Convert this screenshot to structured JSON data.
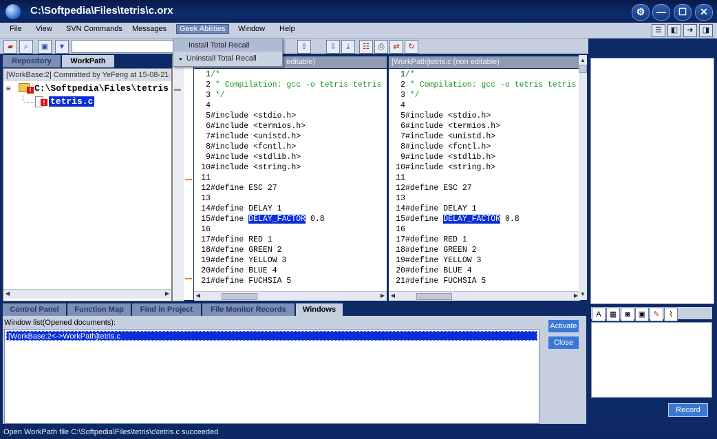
{
  "window": {
    "title": "C:\\Softpedia\\Files\\tetris\\c.orx",
    "controls": [
      "⚙",
      "—",
      "☐",
      "✕"
    ]
  },
  "menubar": {
    "items": [
      "File",
      "View",
      "SVN Commands",
      "Messages",
      "Geek Abilities",
      "Window",
      "Help"
    ],
    "active": "Geek Abilities"
  },
  "dropdown": {
    "items": [
      "Install Total Recall",
      "Uninstall Total Recall"
    ],
    "selected_bullet": "●"
  },
  "left": {
    "tabs": [
      "Repository",
      "WorkPath"
    ],
    "active_tab": "WorkPath",
    "header": "[WorkBase:2] Committed by YeFeng at 15-08-21",
    "tree": [
      {
        "label": "C:\\Softpedia\\Files\\tetris",
        "type": "folder"
      },
      {
        "label": "tetris.c",
        "type": "file"
      }
    ]
  },
  "editor_left": {
    "header": "editable)",
    "lines": [
      {
        "n": "1",
        "t": "/*"
      },
      {
        "n": "2",
        "t": " * Compilation: gcc -o tetris tetris"
      },
      {
        "n": "3",
        "t": " */"
      },
      {
        "n": "4",
        "t": ""
      },
      {
        "n": "5",
        "t": "#include <stdio.h>"
      },
      {
        "n": "6",
        "t": "#include <termios.h>"
      },
      {
        "n": "7",
        "t": "#include <unistd.h>"
      },
      {
        "n": "8",
        "t": "#include <fcntl.h>"
      },
      {
        "n": "9",
        "t": "#include <stdlib.h>"
      },
      {
        "n": "10",
        "t": "#include <string.h>"
      },
      {
        "n": "11",
        "t": ""
      },
      {
        "n": "12",
        "t": "#define ESC 27"
      },
      {
        "n": "13",
        "t": ""
      },
      {
        "n": "14",
        "t": "#define DELAY 1"
      },
      {
        "n": "15",
        "t": "#define ",
        "hl": "DELAY_FACTOR",
        "rest": " 0.8"
      },
      {
        "n": "16",
        "t": ""
      },
      {
        "n": "17",
        "t": "#define RED 1"
      },
      {
        "n": "18",
        "t": "#define GREEN 2"
      },
      {
        "n": "19",
        "t": "#define YELLOW 3"
      },
      {
        "n": "20",
        "t": "#define BLUE 4"
      },
      {
        "n": "21",
        "t": "#define FUCHSIA 5"
      }
    ]
  },
  "editor_right": {
    "header": "[WorkPath]tetris.c (non editable)"
  },
  "bottom": {
    "tabs": [
      "Control Panel",
      "Function Map",
      "Find in Project",
      "File Monitor Records",
      "Windows"
    ],
    "active_tab": "Windows",
    "list_label": "Window list(Opened documents):",
    "list_items": [
      "[WorkBase:2<->WorkPath]tetris.c"
    ],
    "activate": "Activate",
    "close": "Close"
  },
  "right": {
    "record": "Record"
  },
  "status": "Open WorkPath file C:\\Softpedia\\Files\\tetris\\c\\tetris.c succeeded",
  "colors": {
    "frame": "#0e2a66",
    "highlight": "#0a2fd6",
    "comment": "#1a9a1a"
  }
}
